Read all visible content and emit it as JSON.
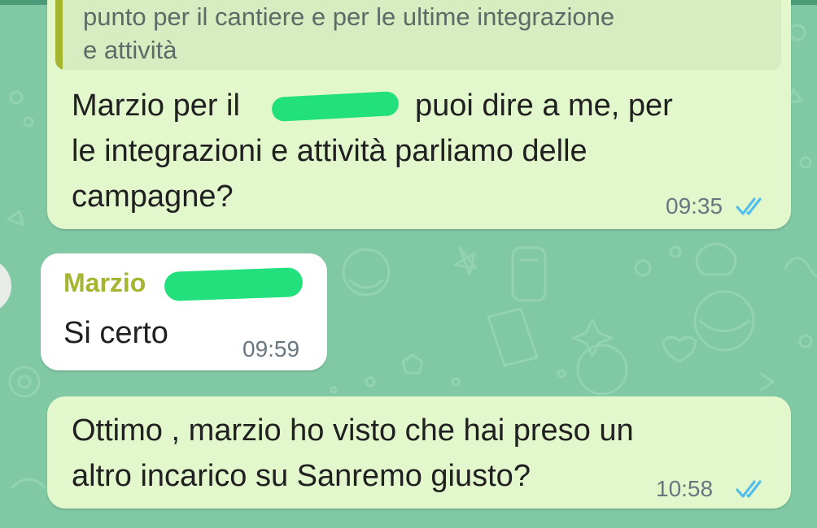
{
  "chat": {
    "messages": [
      {
        "direction": "outgoing",
        "quote": {
          "line1": "punto per il cantiere e per le ultime integrazione",
          "line2": "e attività"
        },
        "line1_a": "Marzio per il ",
        "line1_b": "puoi dire a me, per",
        "line2": "le integrazioni e attività parliamo delle",
        "line3": "campagne?",
        "time": "09:35",
        "status": "read"
      },
      {
        "direction": "incoming",
        "sender": "Marzio",
        "text": "Si certo",
        "time": "09:59"
      },
      {
        "direction": "outgoing",
        "line1": "Ottimo , marzio ho visto che hai preso un",
        "line2": "altro incarico su Sanremo giusto?",
        "time": "10:58",
        "status": "read"
      }
    ]
  },
  "colors": {
    "wallpaper": "#80c9a4",
    "outgoing_bubble": "#e2f7cb",
    "incoming_bubble": "#ffffff",
    "read_ticks": "#53bdeb",
    "sender_name": "#a5b530",
    "redaction_marker": "#22e07c"
  },
  "icons": [
    "double-check-read-icon",
    "contact-avatar"
  ]
}
